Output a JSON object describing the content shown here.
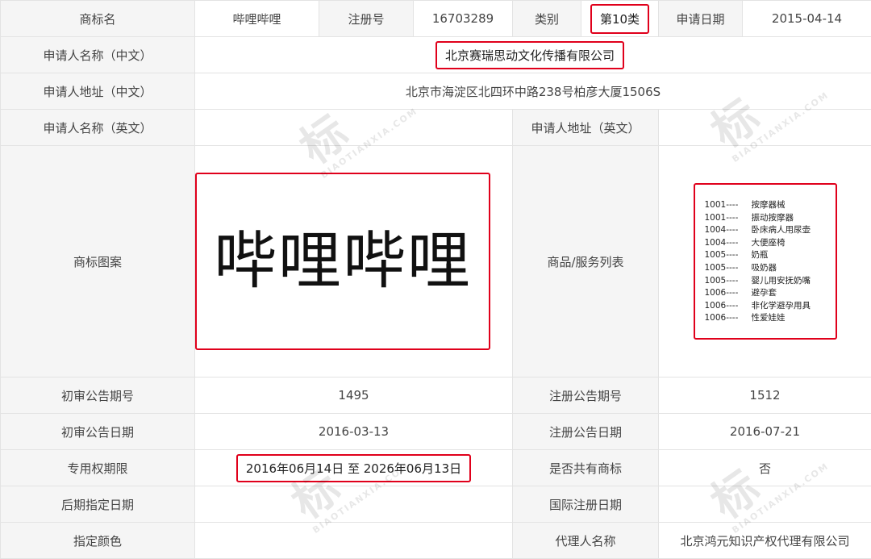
{
  "row1": {
    "mark_name_label": "商标名",
    "mark_name_value": "哔哩哔哩",
    "reg_no_label": "注册号",
    "reg_no_value": "16703289",
    "class_label": "类别",
    "class_value": "第10类",
    "apply_date_label": "申请日期",
    "apply_date_value": "2015-04-14"
  },
  "applicant_cn": {
    "label": "申请人名称（中文）",
    "value": "北京赛瑞思动文化传播有限公司"
  },
  "address_cn": {
    "label": "申请人地址（中文）",
    "value": "北京市海淀区北四环中路238号柏彦大厦1506S"
  },
  "applicant_en": {
    "label": "申请人名称（英文）",
    "value": "",
    "address_label": "申请人地址（英文）",
    "address_value": ""
  },
  "mark_image": {
    "label": "商标图案",
    "text": "哔哩哔哩"
  },
  "goods": {
    "label": "商品/服务列表",
    "items": [
      {
        "code": "1001----",
        "name": "按摩器械"
      },
      {
        "code": "1001----",
        "name": "振动按摩器"
      },
      {
        "code": "1004----",
        "name": "卧床病人用尿壶"
      },
      {
        "code": "1004----",
        "name": "大便座椅"
      },
      {
        "code": "1005----",
        "name": "奶瓶"
      },
      {
        "code": "1005----",
        "name": "吸奶器"
      },
      {
        "code": "1005----",
        "name": "婴儿用安抚奶嘴"
      },
      {
        "code": "1006----",
        "name": "避孕套"
      },
      {
        "code": "1006----",
        "name": "非化学避孕用具"
      },
      {
        "code": "1006----",
        "name": "性爱娃娃"
      }
    ]
  },
  "prelim_no": {
    "label": "初审公告期号",
    "value": "1495",
    "reg_label": "注册公告期号",
    "reg_value": "1512"
  },
  "prelim_date": {
    "label": "初审公告日期",
    "value": "2016-03-13",
    "reg_label": "注册公告日期",
    "reg_value": "2016-07-21"
  },
  "exclusive": {
    "label": "专用权期限",
    "value": "2016年06月14日 至 2026年06月13日",
    "shared_label": "是否共有商标",
    "shared_value": "否"
  },
  "later_date": {
    "label": "后期指定日期",
    "value": "",
    "intl_label": "国际注册日期",
    "intl_value": ""
  },
  "color": {
    "label": "指定颜色",
    "value": "",
    "agent_label": "代理人名称",
    "agent_value": "北京鸿元知识产权代理有限公司"
  },
  "watermark": {
    "glyph": "标",
    "text": "BIAOTIANXIA.COM"
  },
  "colors": {
    "highlight_border": "#e0001b",
    "label_bg": "#f5f5f5",
    "grid": "#e3e3e3"
  }
}
